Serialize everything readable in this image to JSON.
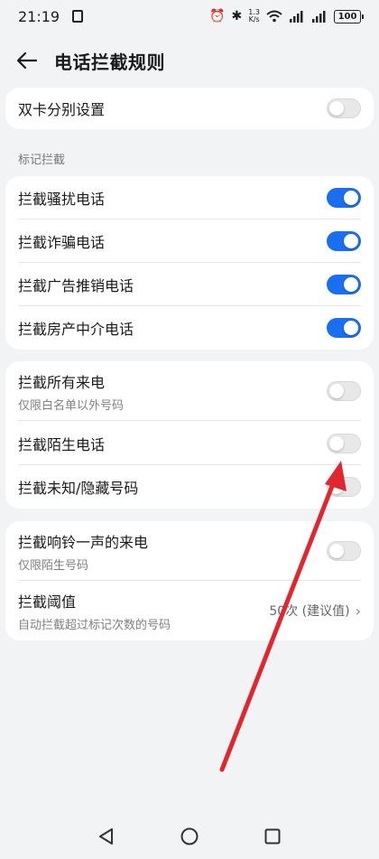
{
  "status_bar": {
    "time": "21:19",
    "net_speed_value": "1.3",
    "net_speed_unit": "K/s",
    "battery": "100"
  },
  "header": {
    "title": "电话拦截规则"
  },
  "dual_sim": {
    "label": "双卡分别设置",
    "enabled": false
  },
  "mark_section": {
    "title": "标记拦截",
    "items": [
      {
        "label": "拦截骚扰电话",
        "enabled": true
      },
      {
        "label": "拦截诈骗电话",
        "enabled": true
      },
      {
        "label": "拦截广告推销电话",
        "enabled": true
      },
      {
        "label": "拦截房产中介电话",
        "enabled": true
      }
    ]
  },
  "call_block": {
    "all_calls": {
      "label": "拦截所有来电",
      "sub": "仅限白名单以外号码",
      "enabled": false
    },
    "stranger": {
      "label": "拦截陌生电话",
      "enabled": false
    },
    "unknown": {
      "label": "拦截未知/隐藏号码",
      "enabled": false
    }
  },
  "ring_once": {
    "label": "拦截响铃一声的来电",
    "sub": "仅限陌生号码",
    "enabled": false
  },
  "threshold": {
    "label": "拦截阈值",
    "sub": "自动拦截超过标记次数的号码",
    "value": "50次 (建议值)"
  },
  "colors": {
    "accent": "#1a6ff0",
    "background": "#f1f3f5",
    "annotation_arrow": "#e0262e"
  },
  "icons": {
    "back": "back-arrow-icon",
    "nav_back": "triangle-back-icon",
    "nav_home": "circle-home-icon",
    "nav_recents": "square-recents-icon"
  }
}
